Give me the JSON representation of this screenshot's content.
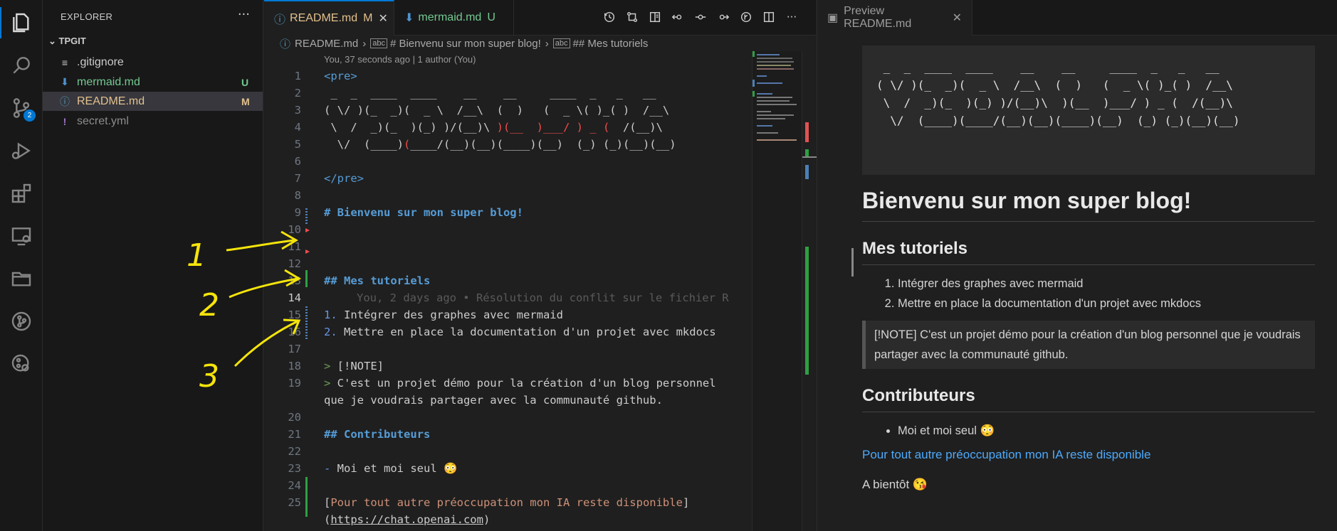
{
  "activity_bar": {
    "scm_badge": "2",
    "items": [
      "explorer-icon",
      "search-icon",
      "source-control-icon",
      "run-debug-icon",
      "extensions-icon",
      "remote-explorer-icon",
      "folder-icon",
      "git-graph-icon",
      "git-history-icon"
    ]
  },
  "explorer": {
    "title": "EXPLORER",
    "more": "···",
    "project": "TPGIT",
    "files": [
      {
        "name": ".gitignore",
        "status": "",
        "color": "#cccccc",
        "icon": "≡"
      },
      {
        "name": "mermaid.md",
        "status": "U",
        "color": "#73c991",
        "icon": "⬇"
      },
      {
        "name": "README.md",
        "status": "M",
        "color": "#e2c08d",
        "icon": "ⓘ"
      },
      {
        "name": "secret.yml",
        "status": "",
        "color": "#8c8c8c",
        "icon": "!"
      }
    ]
  },
  "editor": {
    "tabs": [
      {
        "label": "README.md",
        "status": "M",
        "close": "✕"
      },
      {
        "label": "mermaid.md",
        "status": "U"
      }
    ],
    "breadcrumb": [
      "README.md",
      "# Bienvenu sur mon super blog!",
      "## Mes tutoriels"
    ],
    "codelens": "You, 37 seconds ago | 1 author (You)",
    "blame": "You, 2 days ago • Résolution du conflit sur le fichier R",
    "lines": {
      "l1": "<pre>",
      "l2": " _  _  ____  ____    __    __     ____  _   _   __",
      "l3a": "( \\/ )(_  _)(  _ \\  /__\\  (  )   (  _ \\( )_( )  /__\\",
      "l4a": " \\  /  _)(_  )(_) )/(__)\\ ",
      "l4b": ")(__  )___/",
      "l4c": " ) _ ( ",
      "l4d": " /(__)\\",
      "l5a": "  \\/  (____)",
      "l5b": "(",
      "l5c": "____/(__)(__)(____)(__)  (_) (_)(__)(__)",
      "l7": "</pre>",
      "l9": "# Bienvenu sur mon super blog!",
      "l13": "## Mes tutoriels",
      "l15n": "1.",
      "l15": " Intégrer des graphes avec mermaid",
      "l16n": "2.",
      "l16": " Mettre en place la documentation d'un projet avec mkdocs",
      "l18a": ">",
      "l18b": " [!NOTE]",
      "l19a": ">",
      "l19b": " C'est un projet démo pour la création d'un blog personnel",
      "l19c": "que je voudrais partager avec la communauté github.",
      "l21": "## Contributeurs",
      "l23a": "-",
      "l23b": " Moi et moi seul 😳",
      "l25a": "[",
      "l25b": "Pour tout autre préoccupation mon IA reste disponible",
      "l25c": "]",
      "l25d": "(",
      "l25e": "https://chat.openai.com",
      "l25f": ")"
    },
    "line_numbers": [
      "1",
      "2",
      "3",
      "4",
      "5",
      "6",
      "7",
      "8",
      "9",
      "10",
      "11",
      "12",
      "13",
      "14",
      "15",
      "16",
      "17",
      "18",
      "19",
      "20",
      "21",
      "22",
      "23",
      "24",
      "25"
    ]
  },
  "preview": {
    "tab": "Preview README.md",
    "ascii": " _  _  ____  ____    __    __     ____  _   _   __\n( \\/ )(_  _)(  _ \\  /__\\  (  )   (  _ \\( )_( )  /__\\\n \\  /  _)(_  )(_) )/(__)\\  )(__  )___/ ) _ (  /(__)\\\n  \\/  (____)(____/(__)(__)(____)(__)  (_) (_)(__)(__)",
    "h1": "Bienvenu sur mon super blog!",
    "h2_tutorials": "Mes tutoriels",
    "tutorials": [
      "Intégrer des graphes avec mermaid",
      "Mettre en place la documentation d'un projet avec mkdocs"
    ],
    "note": "[!NOTE] C'est un projet démo pour la création d'un blog personnel que je voudrais partager avec la communauté github.",
    "h2_contrib": "Contributeurs",
    "contributors": [
      "Moi et moi seul 😳"
    ],
    "link": "Pour tout autre préoccupation mon IA reste disponible",
    "bye": "A bientôt 😘"
  },
  "annotations": [
    "1",
    "2",
    "3"
  ],
  "colors": {
    "accent": "#0078d4",
    "modified": "#e2c08d",
    "untracked": "#73c991",
    "annotation": "#f5e40b"
  }
}
